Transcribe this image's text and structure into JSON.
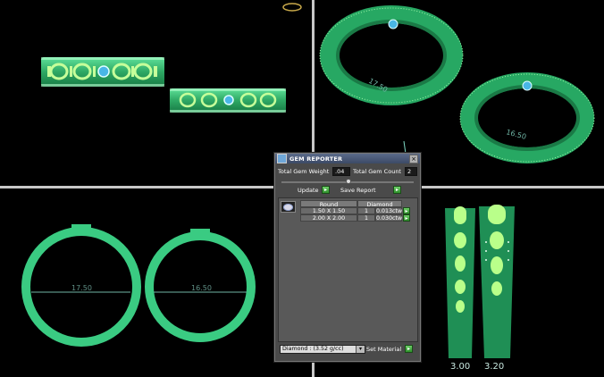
{
  "colors": {
    "ring_green": "#3acb82",
    "ring_dark": "#1f8f55",
    "ring_glow": "#9ef7a8",
    "gem_blue": "#49b6e6",
    "wire": "#7fd8c4",
    "bg": "#000000"
  },
  "viewports": {
    "top_right": {
      "dimension_1": "17.50",
      "dimension_2": "16.50"
    },
    "bottom_left": {
      "dimension_1": "17.50",
      "dimension_2": "16.50"
    },
    "bottom_right": {
      "width_1": "3.00",
      "width_2": "3.20"
    }
  },
  "gem_reporter": {
    "title": "GEM REPORTER",
    "close_label": "×",
    "total_weight_label": "Total Gem Weight",
    "total_weight_value": ".04",
    "total_count_label": "Total Gem Count",
    "total_count_value": "2",
    "update_label": "Update",
    "save_report_label": "Save Report",
    "columns": [
      "Round",
      "Diamond"
    ],
    "rows": [
      {
        "size": "1.50 X 1.50",
        "count": "1",
        "weight": "0.013ctw"
      },
      {
        "size": "2.00 X 2.00",
        "count": "1",
        "weight": "0.030ctw"
      }
    ],
    "material_value": "Diamond : (3.52 g/cc)",
    "set_material_label": "Set Material",
    "button_glyph": "▸"
  }
}
